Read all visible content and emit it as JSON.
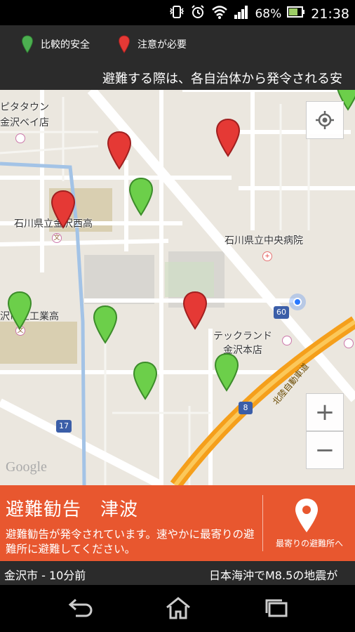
{
  "status": {
    "battery": "68%",
    "time": "21:38"
  },
  "legend": {
    "safe_label": "比較的安全",
    "caution_label": "注意が必要",
    "safe_color": "#4caf50",
    "caution_color": "#e53935"
  },
  "ticker_top": "避難する際は、各自治体から発令される安",
  "map": {
    "labels": {
      "store1a": "ピタタウン",
      "store1b": "金沢ベイ店",
      "school1": "石川県立金沢西高",
      "hospital": "石川県立中央病院",
      "school2": "沢市立工業高",
      "store2a": "テックランド",
      "store2b": "金沢本店",
      "road60": "60",
      "road8": "8",
      "road17": "17",
      "expressway": "北陸自動車道",
      "google": "Google"
    },
    "zoom_in": "+",
    "zoom_out": "−"
  },
  "alert": {
    "title": "避難勧告　津波",
    "body": "避難勧告が発令されています。速やかに最寄りの避難所に避難してください。",
    "button_label": "最寄りの避難所へ"
  },
  "ticker_bottom": {
    "source": "金沢市 - 10分前",
    "message": "日本海沖でM8.5の地震が"
  }
}
